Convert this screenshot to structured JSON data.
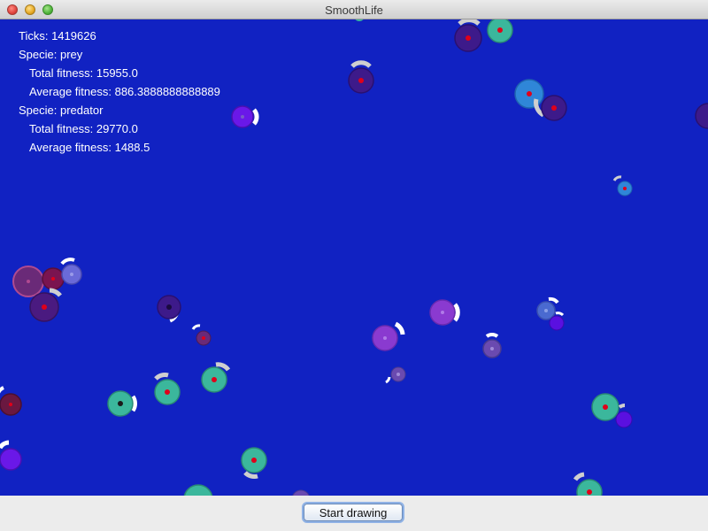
{
  "window": {
    "title": "SmoothLife"
  },
  "stats": {
    "ticks": "Ticks: 1419626",
    "species": [
      {
        "header": "Specie: prey",
        "total": "Total fitness: 15955.0",
        "average": "Average fitness: 886.3888888888889"
      },
      {
        "header": "Specie: predator",
        "total": "Total fitness: 29770.0",
        "average": "Average fitness: 1488.5"
      }
    ]
  },
  "controls": {
    "start_button_label": "Start drawing"
  },
  "colors": {
    "background": "#1122c2",
    "prey": "#3bb79c",
    "predator": "#7d2aa8",
    "eye": "#e0001a"
  }
}
